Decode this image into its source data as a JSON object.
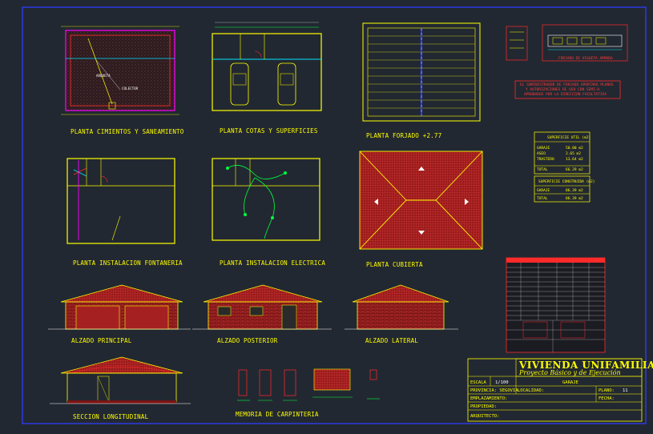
{
  "drawings": {
    "cimientos": "PLANTA CIMIENTOS Y SANEAMIENTO",
    "cotas": "PLANTA COTAS Y SUPERFICIES",
    "forjado": "PLANTA FORJADO +2.77",
    "fontaneria": "PLANTA INSTALACION FONTANERIA",
    "electrica": "PLANTA INSTALACION ELECTRICA",
    "cubierta": "PLANTA CUBIERTA",
    "alzado_principal": "ALZADO PRINCIPAL",
    "alzado_posterior": "ALZADO POSTERIOR",
    "alzado_lateral": "ALZADO LATERAL",
    "seccion": "SECCION LONGITUDINAL",
    "carpinteria": "MEMORIA DE CARPINTERIA"
  },
  "notes": {
    "forjado_note": [
      "EL SUMINISTRADOR DE FORJADO APORTARA PLANOS",
      "Y AUTORIZACIONES DE USO CON SEMI-H",
      "APROBADOS POR LA DIRECCION FACULTATIVA"
    ],
    "detail_caption": "FORJADO DE VIGUETA ARMADA"
  },
  "surface_table": {
    "title": "SUPERFICIE UTIL (m2)",
    "rows": [
      {
        "label": "GARAJE",
        "value": "50.00 m2"
      },
      {
        "label": "ASEO",
        "value": "2.65 m2"
      },
      {
        "label": "TRASTERO",
        "value": "13.64 m2"
      },
      {
        "label": "TOTAL",
        "value": "66.29 m2"
      }
    ],
    "title2": "SUPERFICIE CONSTRUIDA (m2)",
    "rows2": [
      {
        "label": "GARAJE",
        "value": "86.39 m2"
      },
      {
        "label": "TOTAL",
        "value": "86.39 m2"
      }
    ]
  },
  "title_block": {
    "title": "VIVIENDA UNIFAMILIAR",
    "subtitle": "Proyecto Básico y de Ejecución",
    "escala_label": "ESCALA",
    "escala_value": "1/100",
    "garaje": "GARAJE",
    "provincia": "PROVINCIA: SEGOVIA",
    "localidad": "LOCALIDAD:",
    "emplazamiento": "EMPLAZAMIENTO:",
    "plano_label": "PLANO:",
    "plano_value": "11",
    "fecha": "FECHA:",
    "propiedad": "PROPIEDAD:",
    "arquitecto": "ARQUITECTO:"
  },
  "colors": {
    "background": "#222831",
    "border": "#2f3cff",
    "lines": "#ffff00",
    "walls": "#ff2a2a",
    "cyan": "#00e5ff",
    "magenta": "#ff00ff",
    "green": "#00ff3c"
  }
}
